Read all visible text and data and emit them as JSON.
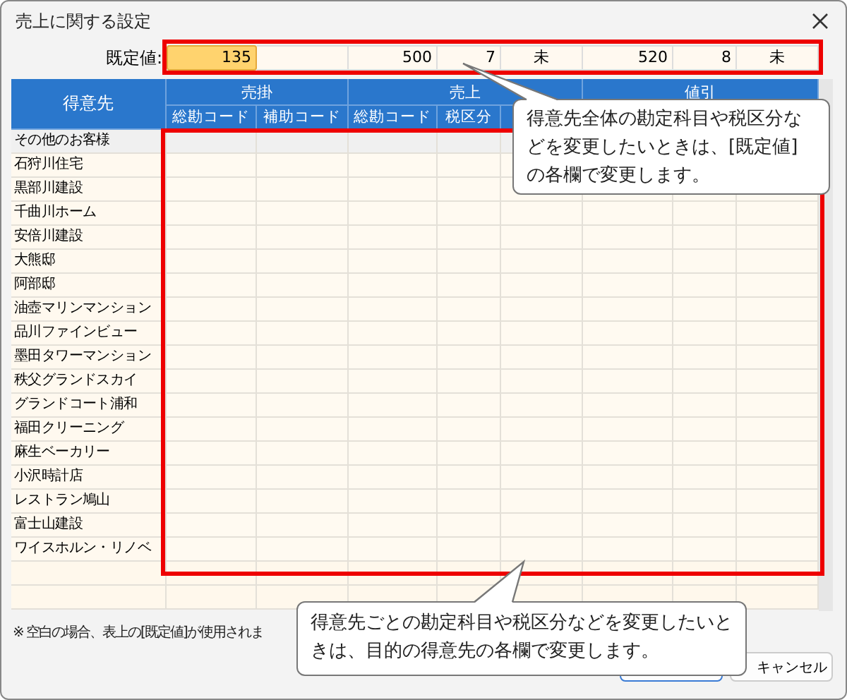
{
  "window": {
    "title": "売上に関する設定"
  },
  "default_row": {
    "label": "既定値:",
    "values": [
      {
        "kind": "number",
        "text": "135",
        "selected": true
      },
      {
        "kind": "blank",
        "selected": false
      },
      {
        "kind": "number",
        "text": "500",
        "selected": false
      },
      {
        "kind": "number",
        "text": "7",
        "selected": false
      },
      {
        "kind": "flag",
        "text": "未",
        "selected": false
      },
      {
        "kind": "number",
        "text": "520",
        "selected": false
      },
      {
        "kind": "number",
        "text": "8",
        "selected": false
      },
      {
        "kind": "flag",
        "text": "未",
        "selected": false
      }
    ]
  },
  "table": {
    "customer_header": "得意先",
    "groups": [
      "売掛",
      "売上",
      "値引"
    ],
    "subheaders": [
      "総勘コード",
      "補助コード",
      "総勘コード",
      "税区分"
    ],
    "rows": [
      {
        "kind": "summary",
        "name": "その他のお客様"
      },
      {
        "kind": "customer",
        "name": "石狩川住宅"
      },
      {
        "kind": "customer",
        "name": "黒部川建設"
      },
      {
        "kind": "customer",
        "name": "千曲川ホーム"
      },
      {
        "kind": "customer",
        "name": "安倍川建設"
      },
      {
        "kind": "customer",
        "name": "大熊邸"
      },
      {
        "kind": "customer",
        "name": "阿部邸"
      },
      {
        "kind": "customer",
        "name": "油壺マリンマンション"
      },
      {
        "kind": "customer",
        "name": "品川ファインビュー"
      },
      {
        "kind": "customer",
        "name": "墨田タワーマンション"
      },
      {
        "kind": "customer",
        "name": "秩父グランドスカイ"
      },
      {
        "kind": "customer",
        "name": "グランドコート浦和"
      },
      {
        "kind": "customer",
        "name": "福田クリーニング"
      },
      {
        "kind": "customer",
        "name": "麻生ベーカリー"
      },
      {
        "kind": "customer",
        "name": "小沢時計店"
      },
      {
        "kind": "customer",
        "name": "レストラン鳩山"
      },
      {
        "kind": "customer",
        "name": "富士山建設"
      },
      {
        "kind": "customer",
        "name": "ワイスホルン・リノベ"
      }
    ]
  },
  "note": "※ 空白の場合、表上の[既定値]が使用されま",
  "buttons": [
    "キャンセル"
  ],
  "callouts": [
    "得意先全体の勘定科目や税区分などを変更したいときは、[既定値]の各欄で変更します。",
    "得意先ごとの勘定科目や税区分などを変更したいときは、目的の得意先の各欄で変更します。"
  ]
}
